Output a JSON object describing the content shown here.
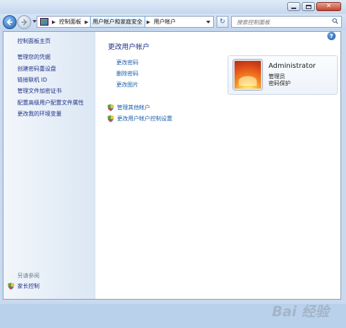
{
  "address": {
    "crumbs": [
      "控制面板",
      "用户帐户和家庭安全",
      "用户帐户"
    ]
  },
  "search": {
    "placeholder": "搜索控制面板"
  },
  "sidebar": {
    "items": [
      {
        "label": "控制面板主页"
      },
      {
        "label": "管理您的凭据"
      },
      {
        "label": "创建密码重设盘"
      },
      {
        "label": "链接联机 ID"
      },
      {
        "label": "管理文件加密证书"
      },
      {
        "label": "配置高级用户配置文件属性"
      },
      {
        "label": "更改我的环境变量"
      }
    ],
    "see_also": "另请参阅",
    "family_safety": "家长控制"
  },
  "main": {
    "title": "更改用户帐户",
    "tasks": [
      "更改密码",
      "删除密码",
      "更改图片"
    ],
    "shield_tasks": [
      "管理其他帐户",
      "更改用户帐户控制设置"
    ]
  },
  "user": {
    "name": "Administrator",
    "role": "管理员",
    "protection": "密码保护"
  },
  "watermark": "Bai 经验",
  "colors": {
    "link": "#1c5ea9",
    "heading": "#1e3287",
    "window_frame": "#c9daf0"
  }
}
